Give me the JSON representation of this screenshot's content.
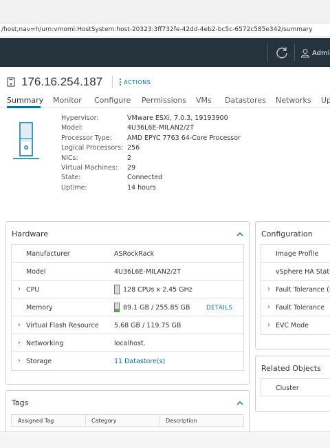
{
  "browser": {
    "url": "/host;nav=h/urn:vmomi:HostSystem:host-20323:3ff732fe-42dd-4eb2-bc5c-6572c585e342/summary"
  },
  "header": {
    "user_label": "Admi",
    "background_color": "#25333d"
  },
  "host": {
    "title": "176.16.254.187",
    "actions_label": "ACTIONS"
  },
  "tabs": [
    {
      "label": "Summary"
    },
    {
      "label": "Monitor"
    },
    {
      "label": "Configure"
    },
    {
      "label": "Permissions"
    },
    {
      "label": "VMs"
    },
    {
      "label": "Datastores"
    },
    {
      "label": "Networks"
    },
    {
      "label": "Up"
    }
  ],
  "info": [
    {
      "key": "Hypervisor:",
      "value": "VMware ESXi, 7.0.3, 19193900"
    },
    {
      "key": "Model:",
      "value": "4U36L6E-MILAN2/2T"
    },
    {
      "key": "Processor Type:",
      "value": "AMD EPYC 7763 64-Core Processor"
    },
    {
      "key": "Logical Processors:",
      "value": "256"
    },
    {
      "key": "NICs:",
      "value": "2"
    },
    {
      "key": "Virtual Machines:",
      "value": "29"
    },
    {
      "key": "State:",
      "value": "Connected"
    },
    {
      "key": "Uptime:",
      "value": "14 hours"
    }
  ],
  "hardware": {
    "title": "Hardware",
    "rows": [
      {
        "label": "Manufacturer",
        "value": "ASRockRack"
      },
      {
        "label": "Model",
        "value": "4U36L6E-MILAN2/2T"
      },
      {
        "label": "CPU",
        "value": "128 CPUs x 2.45 GHz",
        "usage_fraction": 0.0
      },
      {
        "label": "Memory",
        "value": "89.1 GB / 255.85 GB",
        "usage_fraction": 0.35,
        "link": "DETAILS"
      },
      {
        "label": "Virtual Flash Resource",
        "value": "5.68 GB / 119.75 GB"
      },
      {
        "label": "Networking",
        "value": "localhost."
      },
      {
        "label": "Storage",
        "value": "11 Datastore(s)"
      }
    ]
  },
  "configuration": {
    "title": "Configuration",
    "rows": [
      {
        "label": "Image Profile"
      },
      {
        "label": "vSphere HA State"
      },
      {
        "label": "Fault Tolerance (L"
      },
      {
        "label": "Fault Tolerance"
      },
      {
        "label": "EVC Mode"
      }
    ]
  },
  "related": {
    "title": "Related Objects",
    "row": "Cluster"
  },
  "tags": {
    "title": "Tags",
    "columns": [
      "Assigned Tag",
      "Category",
      "Description"
    ]
  },
  "colors": {
    "link": "#0072a3",
    "memory_bar": "#3fbf3f"
  }
}
